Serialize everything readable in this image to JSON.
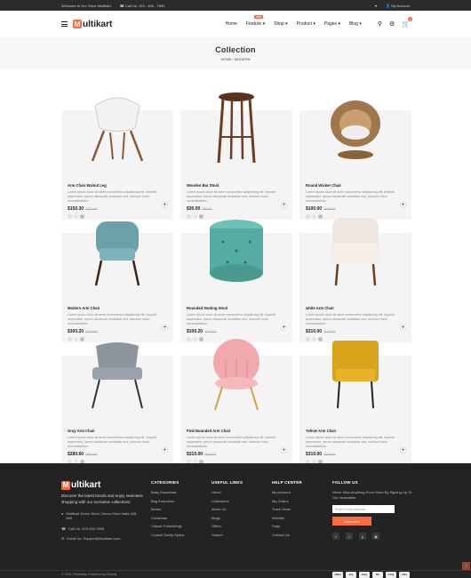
{
  "topbar": {
    "welcome": "Welcome to Our Store Multikart",
    "call": "Call Us: 123 - 456 - 7890",
    "account": "My Account"
  },
  "brand": {
    "logo_letter": "M",
    "logo_text": "ultikart"
  },
  "nav": {
    "items": [
      {
        "label": "Home"
      },
      {
        "label": "Feature",
        "badge": "new"
      },
      {
        "label": "Shop"
      },
      {
        "label": "Product"
      },
      {
        "label": "Pages"
      },
      {
        "label": "Blog"
      }
    ],
    "cart_count": "0"
  },
  "page": {
    "title": "Collection",
    "breadcrumb": "HOME / MODERN"
  },
  "products": [
    {
      "name": "Arm Chair Walnut Leg",
      "desc": "Lorem ipsum dolor sit amet consectetur adipisicing elit. Impedit aspernatur, ipsum obcaecati molestiae sed, dolorum iusto necessitatibus",
      "price": "$150.30",
      "old": "$300.00"
    },
    {
      "name": "Wooden Bar Stool",
      "desc": "Lorem ipsum dolor sit amet consectetur adipisicing elit. Impedit aspernatur, ipsum obcaecati molestiae sed, dolorum iusto necessitatibus",
      "price": "$30.00",
      "old": "$40.00"
    },
    {
      "name": "Round Wicker Chair",
      "desc": "Lorem ipsum dolor sit amet consectetur adipisicing elit. Impedit aspernatur, ipsum obcaecati molestiae sed, dolorum iusto necessitatibus",
      "price": "$100.00",
      "old": "$250.00"
    },
    {
      "name": "Modern Arm Chair",
      "desc": "Lorem ipsum dolor sit amet consectetur adipisicing elit. Impedit aspernatur, ipsum obcaecati molestiae sed, dolorum iusto necessitatibus",
      "price": "$300.20",
      "old": "$420.00"
    },
    {
      "name": "Rounded Seating Stool",
      "desc": "Lorem ipsum dolor sit amet consectetur adipisicing elit. Impedit aspernatur, ipsum obcaecati molestiae sed, dolorum iusto necessitatibus",
      "price": "$100.20",
      "old": "$150.00"
    },
    {
      "name": "white Arm Chair",
      "desc": "Lorem ipsum dolor sit amet consectetur adipisicing elit. Impedit aspernatur, ipsum obcaecati molestiae sed, dolorum iusto necessitatibus",
      "price": "$310.00",
      "old": "$320.00"
    },
    {
      "name": "Gray Arm Chair",
      "desc": "Lorem ipsum dolor sit amet consectetur adipisicing elit. Impedit aspernatur, ipsum obcaecati molestiae sed, dolorum iusto necessitatibus",
      "price": "$280.60",
      "old": "$300.00"
    },
    {
      "name": "Pink Bounded Arm Chair",
      "desc": "Lorem ipsum dolor sit amet consectetur adipisicing elit. Impedit aspernatur, ipsum obcaecati molestiae sed, dolorum iusto necessitatibus",
      "price": "$310.00",
      "old": "$320.00"
    },
    {
      "name": "Yellow Arm Chair",
      "desc": "Lorem ipsum dolor sit amet consectetur adipisicing elit. Impedit aspernatur, ipsum obcaecati molestiae sed, dolorum iusto necessitatibus",
      "price": "$310.00",
      "old": "$320.00"
    }
  ],
  "swatch_colors": [
    "#cfe4f5",
    "#e4e4e4",
    "#bdbdbd"
  ],
  "accent_color": "#ff6a3d",
  "footer": {
    "about": "Discover the latest trends and enjoy seamless shopping with our exclusive collections.",
    "address": "Multikart Demo Store, Demo Store India 345-659",
    "phone": "Call Us: 123-456-7898",
    "email": "Email Us: Support@Multikart.com",
    "categories": {
      "title": "CATEGORIES",
      "links": [
        "Baby Essentials",
        "Bag Emporium",
        "Books",
        "Christmas",
        "Classic Furnishings",
        "Crystal Clarity Optics"
      ]
    },
    "useful": {
      "title": "USEFUL LINKS",
      "links": [
        "Home",
        "Collections",
        "About Us",
        "Blogs",
        "Offers",
        "Search"
      ]
    },
    "help": {
      "title": "HELP CENTER",
      "links": [
        "My Account",
        "My Orders",
        "Track Order",
        "Wishlist",
        "Faqs",
        "Contact Us"
      ]
    },
    "follow": {
      "title": "FOLLOW US",
      "text": "Never Miss Anything From Store By Signing Up To Our Newsletter.",
      "placeholder": "Enter Email Address",
      "button": "Subscribe"
    },
    "copyright": "© 2024, Pixelstrap Powered by Shopify",
    "payments": [
      "AMEX",
      "Pay",
      "GPay",
      "MC",
      "G Pay",
      "VISA"
    ]
  }
}
